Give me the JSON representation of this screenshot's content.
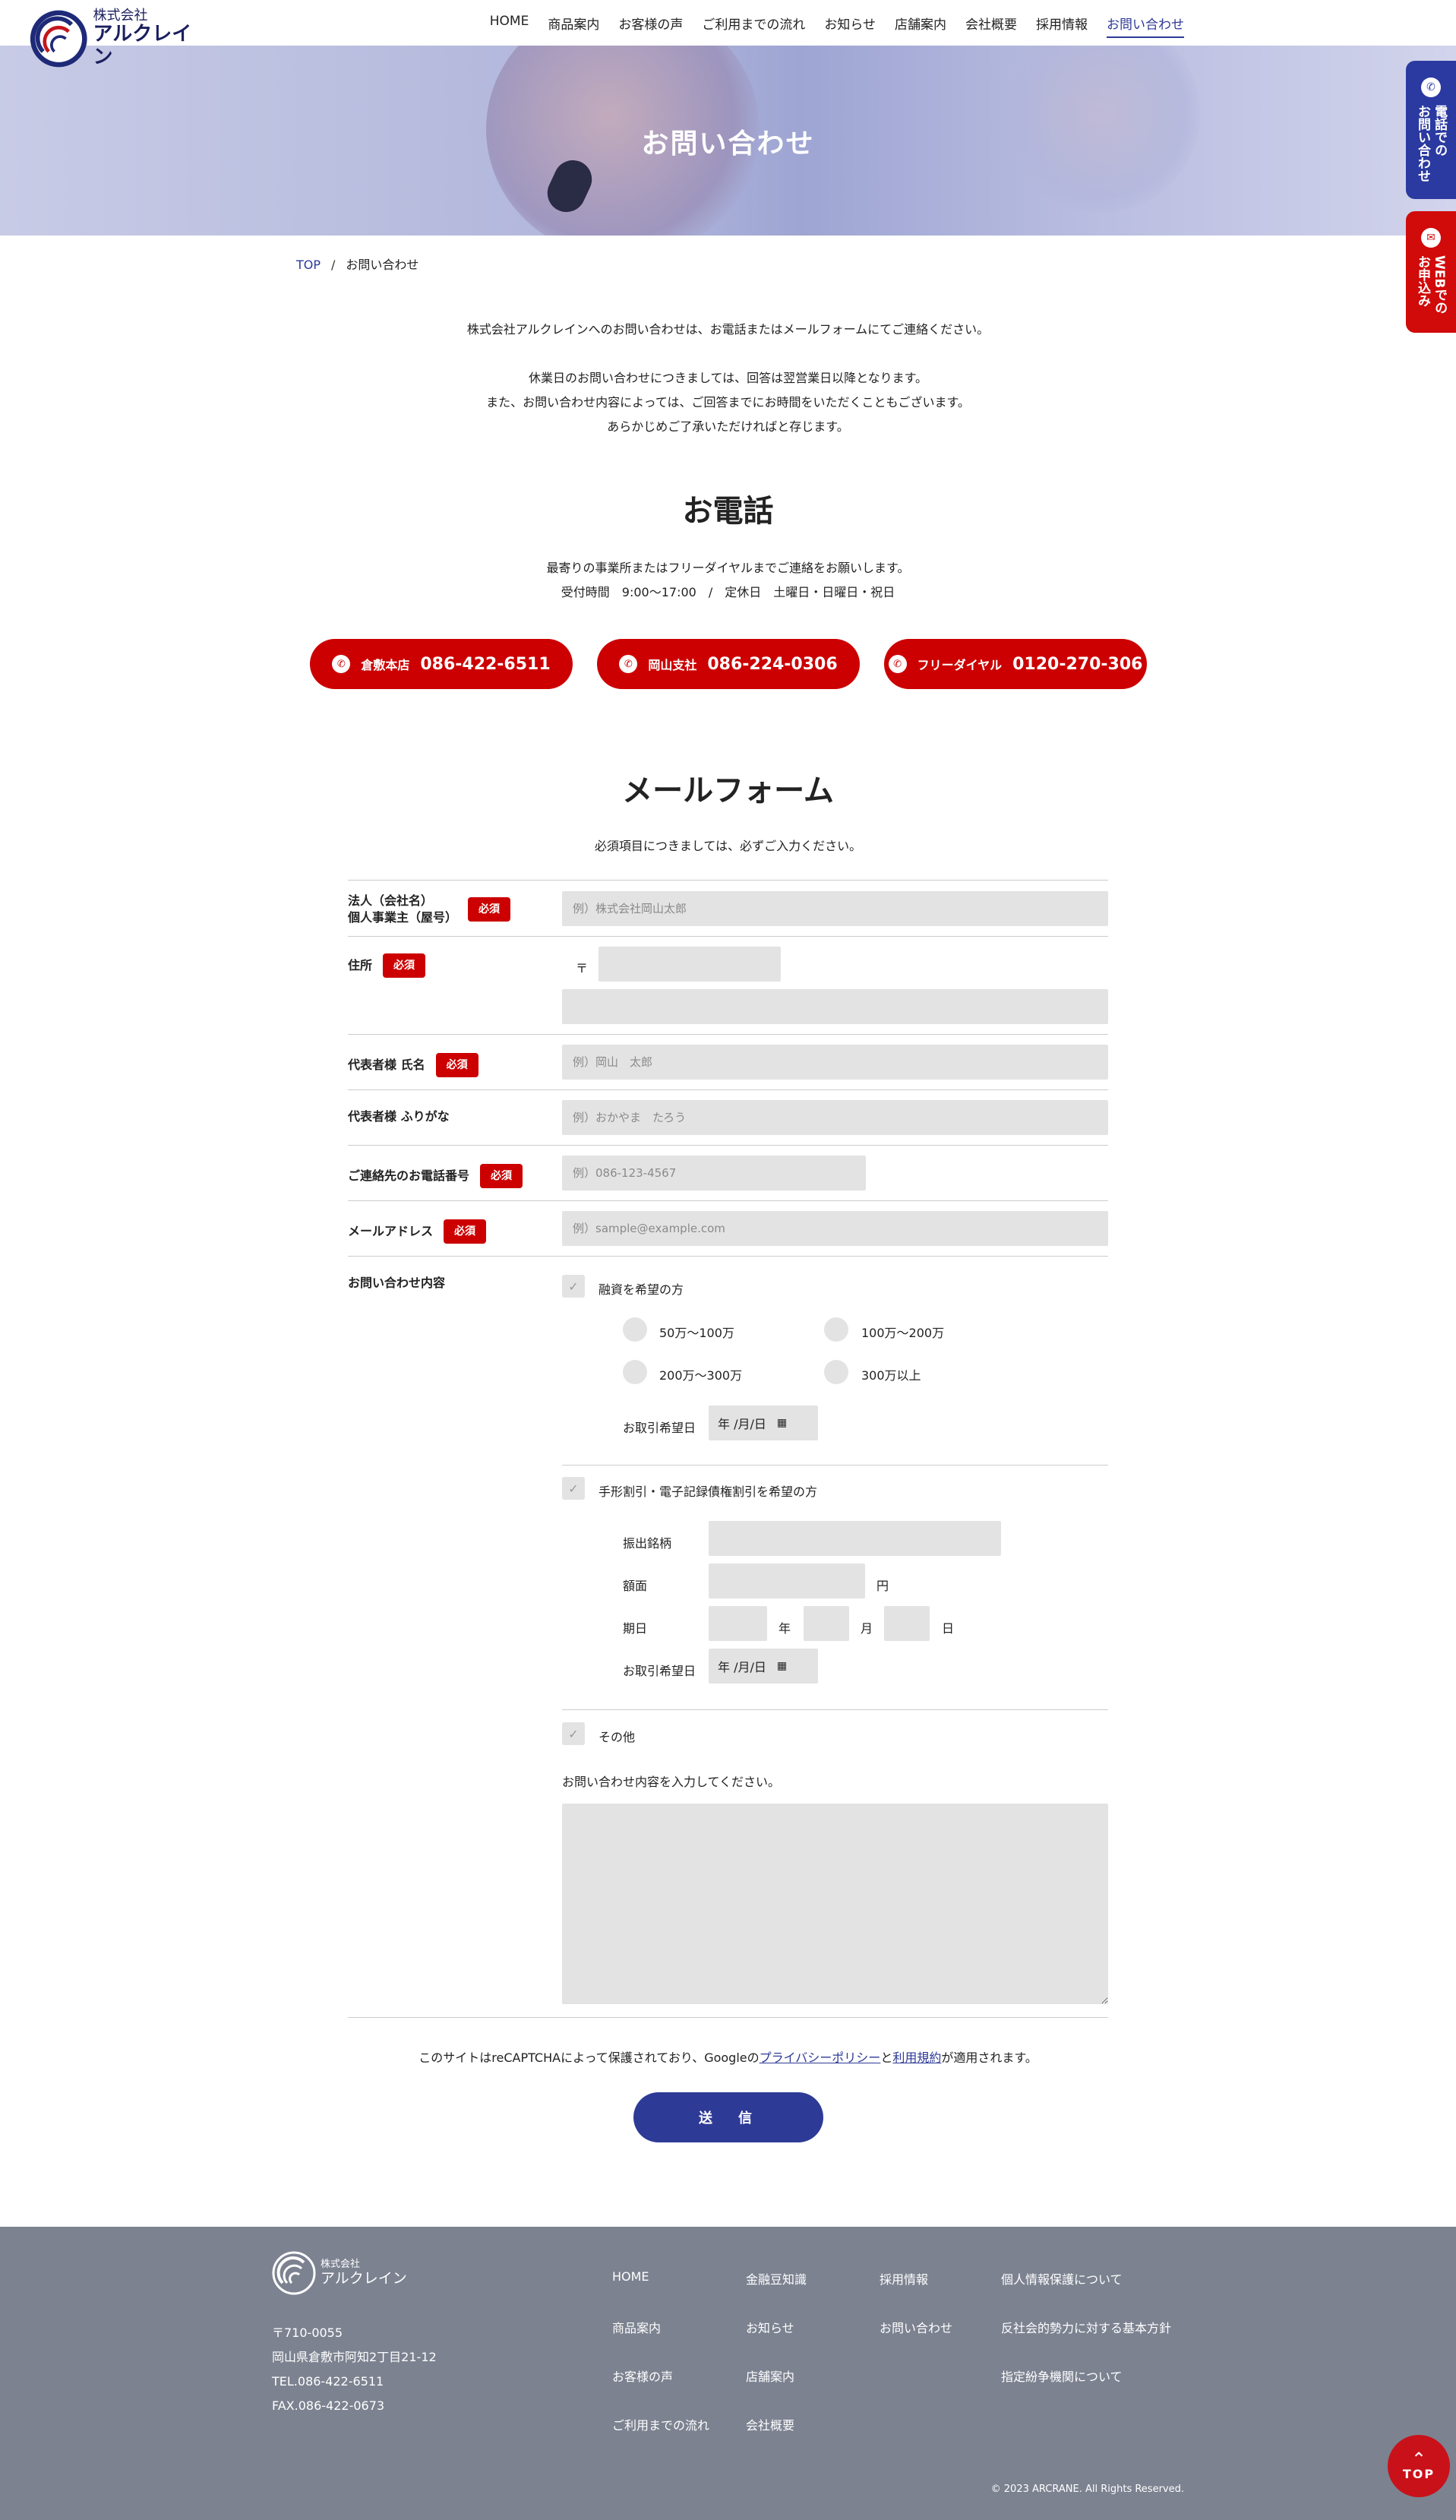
{
  "header": {
    "logo_small": "株式会社",
    "logo_big": "アルクレイン",
    "nav": [
      "HOME",
      "商品案内",
      "お客様の声",
      "ご利用までの流れ",
      "お知らせ",
      "店舗案内",
      "会社概要",
      "採用情報",
      "お問い合わせ"
    ]
  },
  "hero": {
    "title": "お問い合わせ"
  },
  "side": {
    "tel": "電話での\nお問い合わせ",
    "web": "WEBでの\nお申込み"
  },
  "breadcrumb": {
    "top": "TOP",
    "sep": "/",
    "current": "お問い合わせ"
  },
  "intro": {
    "line1": "株式会社アルクレインへのお問い合わせは、お電話またはメールフォームにてご連絡ください。",
    "line2": "休業日のお問い合わせにつきましては、回答は翌営業日以降となります。",
    "line3": "また、お問い合わせ内容によっては、ご回答までにお時間をいただくこともございます。",
    "line4": "あらかじめご了承いただければと存じます。"
  },
  "phone": {
    "title": "お電話",
    "desc1": "最寄りの事業所またはフリーダイヤルまでご連絡をお願いします。",
    "desc2": "受付時間　9:00～17:00　/　定休日　土曜日・日曜日・祝日",
    "buttons": [
      {
        "name": "倉敷本店",
        "number": "086-422-6511"
      },
      {
        "name": "岡山支社",
        "number": "086-224-0306"
      },
      {
        "name": "フリーダイヤル",
        "number": "0120-270-306"
      }
    ]
  },
  "mailform": {
    "title": "メールフォーム",
    "note": "必須項目につきましては、必ずご入力ください。",
    "required": "必須",
    "company_label1": "法人（会社名）",
    "company_label2": "個人事業主（屋号）",
    "company_placeholder": "例）株式会社岡山太郎",
    "address_label": "住所",
    "postal_mark": "〒",
    "name_label": "代表者様 氏名",
    "name_placeholder": "例）岡山　太郎",
    "kana_label": "代表者様 ふりがな",
    "kana_placeholder": "例）おかやま　たろう",
    "tel_label": "ご連絡先のお電話番号",
    "tel_placeholder": "例）086-123-4567",
    "email_label": "メールアドレス",
    "email_placeholder": "例）sample@example.com",
    "content_label": "お問い合わせ内容",
    "loan_label": "融資を希望の方",
    "loan_options": [
      "50万～100万",
      "100万～200万",
      "200万～300万",
      "300万以上"
    ],
    "date_label": "お取引希望日",
    "date_placeholder": "年 /月/日",
    "bill_label": "手形割引・電子記録債権割引を希望の方",
    "drawer_label": "振出銘柄",
    "amount_label": "額面",
    "yen": "円",
    "due_label": "期日",
    "year": "年",
    "month": "月",
    "day": "日",
    "other_label": "その他",
    "content_prompt": "お問い合わせ内容を入力してください。",
    "recaptcha_pre": "このサイトはreCAPTCHAによって保護されており、Googleの",
    "privacy_link": "プライバシーポリシー",
    "and": "と",
    "terms_link": "利用規約",
    "recaptcha_post": "が適用されます。",
    "submit": "送　信"
  },
  "footer": {
    "logo_small": "株式会社",
    "logo_big": "アルクレイン",
    "postal": "〒710-0055",
    "address": "岡山県倉敷市阿知2丁目21-12",
    "tel": "TEL.086-422-6511",
    "fax": "FAX.086-422-0673",
    "col1": [
      "HOME",
      "商品案内",
      "お客様の声",
      "ご利用までの流れ"
    ],
    "col2": [
      "金融豆知識",
      "お知らせ",
      "店舗案内",
      "会社概要"
    ],
    "col3": [
      "採用情報",
      "お問い合わせ"
    ],
    "col4": [
      "個人情報保護について",
      "反社会的勢力に対する基本方針",
      "指定紛争機関について"
    ],
    "copyright": "© 2023 ARCRANE. All Rights Reserved."
  },
  "pagetop": "TOP",
  "colors": {
    "primary": "#2d3a96",
    "red": "#cc0000",
    "footer_bg": "#7c8290",
    "field_bg": "#e3e3e3"
  }
}
